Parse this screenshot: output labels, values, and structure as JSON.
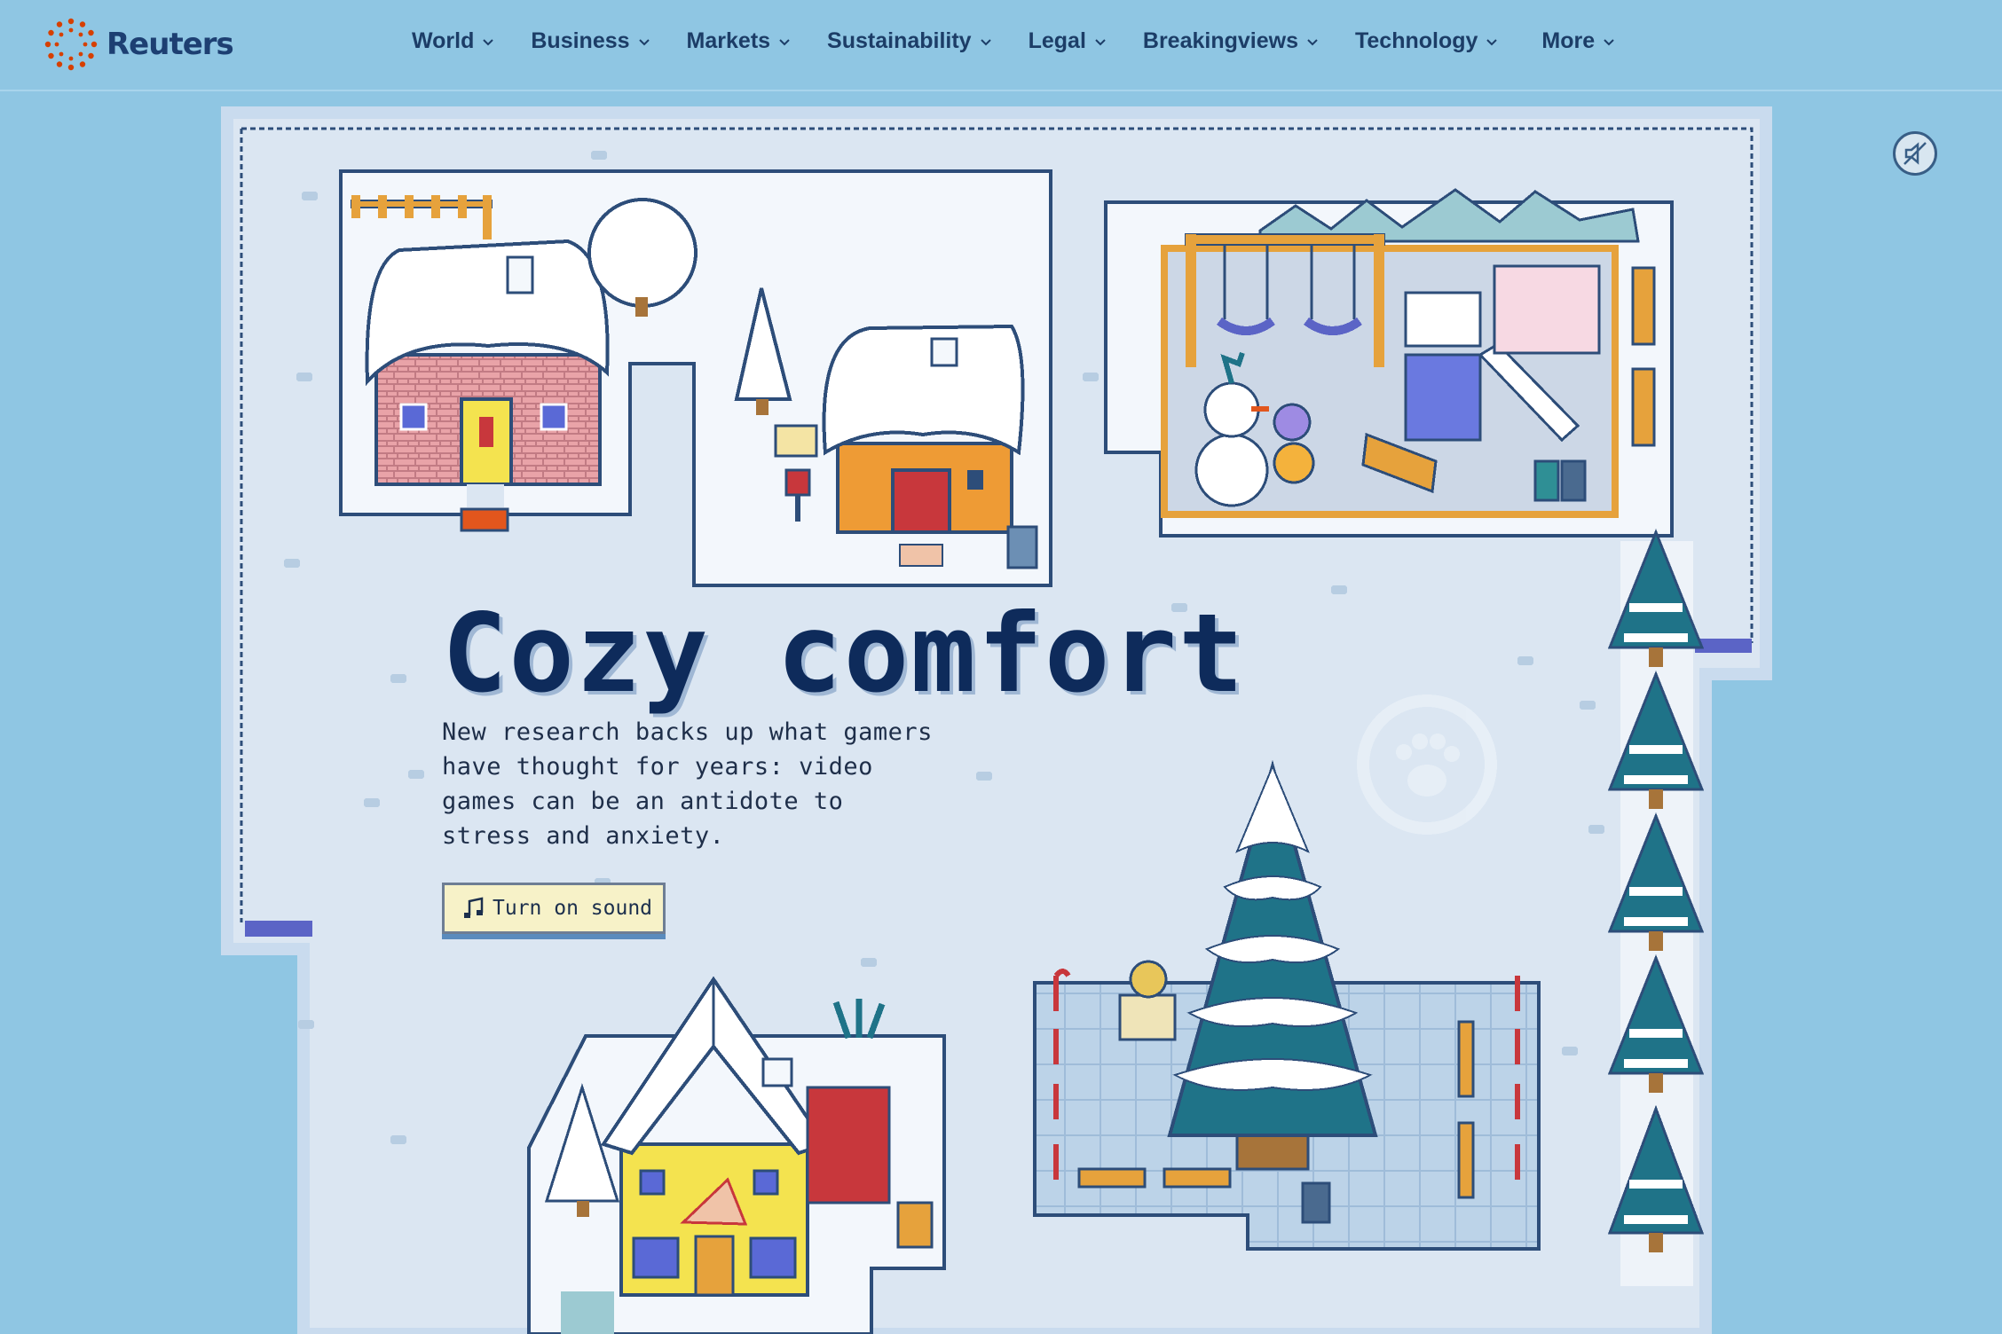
{
  "site": {
    "brand": "Reuters",
    "brand_color": "#d64000"
  },
  "nav": {
    "items": [
      {
        "label": "World"
      },
      {
        "label": "Business"
      },
      {
        "label": "Markets"
      },
      {
        "label": "Sustainability"
      },
      {
        "label": "Legal"
      },
      {
        "label": "Breakingviews"
      },
      {
        "label": "Technology"
      },
      {
        "label": "More"
      }
    ]
  },
  "hero": {
    "title": "Cozy comfort",
    "subtitle": "New research backs up what gamers have thought for years: video games can be an antidote to stress and anxiety.",
    "sound_button_label": "Turn on sound"
  },
  "icons": {
    "sound_toggle": "muted-speaker-icon",
    "sound_button": "music-note-icon"
  },
  "colors": {
    "background": "#8fc6e3",
    "snow_ground": "#dbe6f2",
    "title": "#0e2b5b",
    "tree": "#1f7388",
    "button_bg": "#f7f2c8"
  }
}
